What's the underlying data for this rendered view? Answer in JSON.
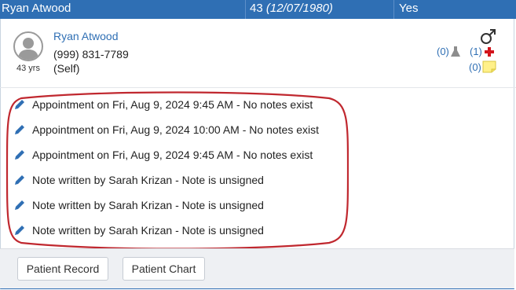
{
  "top_row": {
    "name": "Ryan Atwood",
    "age": "43",
    "dob": "(12/07/1980)",
    "flag": "Yes"
  },
  "patient": {
    "name": "Ryan Atwood",
    "phone": "(999) 831-7789",
    "relation": "(Self)",
    "age_label": "43 yrs"
  },
  "indicators": {
    "labs_count": "(0)",
    "medical_count": "(1)",
    "notes_count": "(0)"
  },
  "items": [
    {
      "text": "Appointment on Fri, Aug 9, 2024 9:45 AM - No notes exist"
    },
    {
      "text": "Appointment on Fri, Aug 9, 2024 10:00 AM - No notes exist"
    },
    {
      "text": "Appointment on Fri, Aug 9, 2024 9:45 AM - No notes exist"
    },
    {
      "text": "Note written by Sarah Krizan - Note is unsigned"
    },
    {
      "text": "Note written by Sarah Krizan - Note is unsigned"
    },
    {
      "text": "Note written by Sarah Krizan - Note is unsigned"
    }
  ],
  "buttons": {
    "patient_record": "Patient Record",
    "patient_chart": "Patient Chart"
  },
  "colors": {
    "accent": "#2f6fb4",
    "annotation": "#c0282f",
    "medical_cross": "#d3141c",
    "note_yellow": "#fff08a"
  },
  "icons": [
    "male-gender-icon",
    "flask-icon",
    "red-cross-icon",
    "note-icon",
    "pencil-icon"
  ]
}
